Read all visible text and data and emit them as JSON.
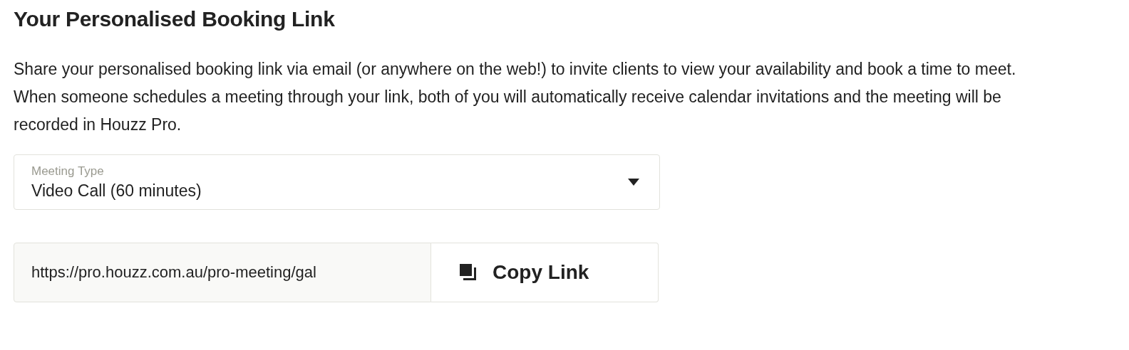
{
  "heading": "Your Personalised Booking Link",
  "description": "Share your personalised booking link via email (or anywhere on the web!) to invite clients to view your availability and book a time to meet. When someone schedules a meeting through your link, both of you will automatically receive calendar invitations and the meeting will be recorded in Houzz Pro.",
  "meeting_type": {
    "label": "Meeting Type",
    "value": "Video Call (60 minutes)"
  },
  "link": {
    "value": "https://pro.houzz.com.au/pro-meeting/gal",
    "button": "Copy Link"
  }
}
